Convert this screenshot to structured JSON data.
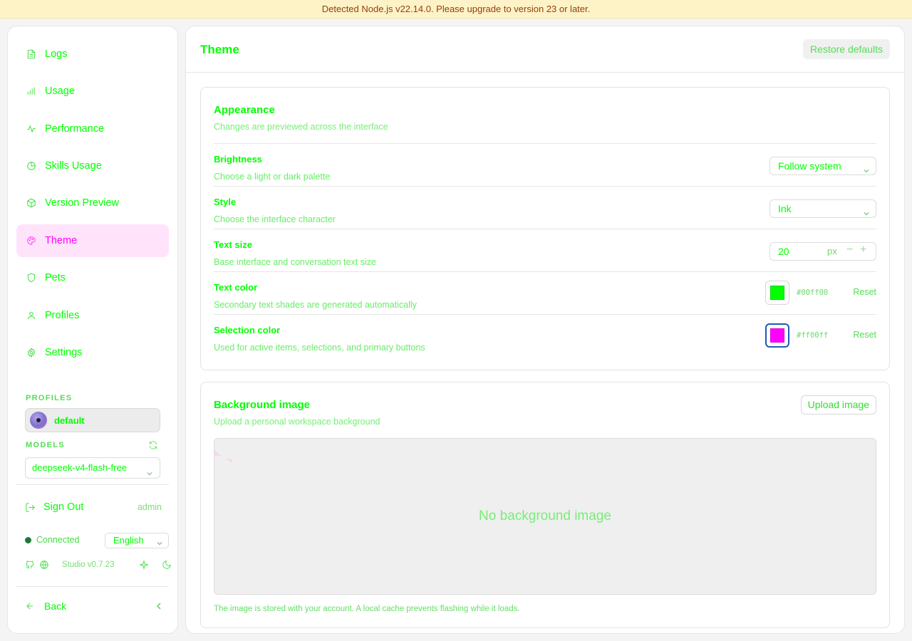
{
  "banner": {
    "text": "Detected Node.js v22.14.0. Please upgrade to version 23 or later."
  },
  "sidebar": {
    "nav": [
      {
        "label": "Logs",
        "icon": "file-text-icon"
      },
      {
        "label": "Usage",
        "icon": "bar-chart-icon"
      },
      {
        "label": "Performance",
        "icon": "activity-icon"
      },
      {
        "label": "Skills Usage",
        "icon": "pie-chart-icon"
      },
      {
        "label": "Version Preview",
        "icon": "package-icon"
      },
      {
        "label": "Theme",
        "icon": "palette-icon",
        "active": true
      },
      {
        "label": "Pets",
        "icon": "shield-icon"
      },
      {
        "label": "Profiles",
        "icon": "user-icon"
      },
      {
        "label": "Settings",
        "icon": "gear-icon"
      }
    ],
    "profiles_label": "PROFILES",
    "profile_name": "default",
    "models_label": "MODELS",
    "model_selected": "deepseek-v4-flash-free",
    "sign_out": "Sign Out",
    "user": "admin",
    "status": "Connected",
    "language": "English",
    "version": "Studio v0.7.23",
    "back": "Back"
  },
  "main": {
    "title": "Theme",
    "restore_label": "Restore defaults",
    "appearance": {
      "title": "Appearance",
      "subtitle": "Changes are previewed across the interface",
      "brightness": {
        "label": "Brightness",
        "desc": "Choose a light or dark palette",
        "value": "Follow system"
      },
      "style": {
        "label": "Style",
        "desc": "Choose the interface character",
        "value": "Ink"
      },
      "text_size": {
        "label": "Text size",
        "desc": "Base interface and conversation text size",
        "value": "20",
        "unit": "px",
        "minus": "−",
        "plus": "+"
      },
      "text_color": {
        "label": "Text color",
        "desc": "Secondary text shades are generated automatically",
        "hex": "#00ff00",
        "reset": "Reset",
        "color": "#00ff00"
      },
      "selection_color": {
        "label": "Selection color",
        "desc": "Used for active items, selections, and primary buttons",
        "hex": "#ff00ff",
        "reset": "Reset",
        "color": "#ff00ff"
      }
    },
    "background": {
      "title": "Background image",
      "subtitle": "Upload a personal workspace background",
      "upload_label": "Upload image",
      "empty_text": "No background image",
      "note": "The image is stored with your account. A local cache prevents flashing while it loads."
    }
  },
  "colors": {
    "accent": "#ff00ff",
    "text": "#00ff00",
    "active_bg": "#ffe3fb",
    "banner_bg": "#fef3c7",
    "banner_text": "#92400e"
  }
}
